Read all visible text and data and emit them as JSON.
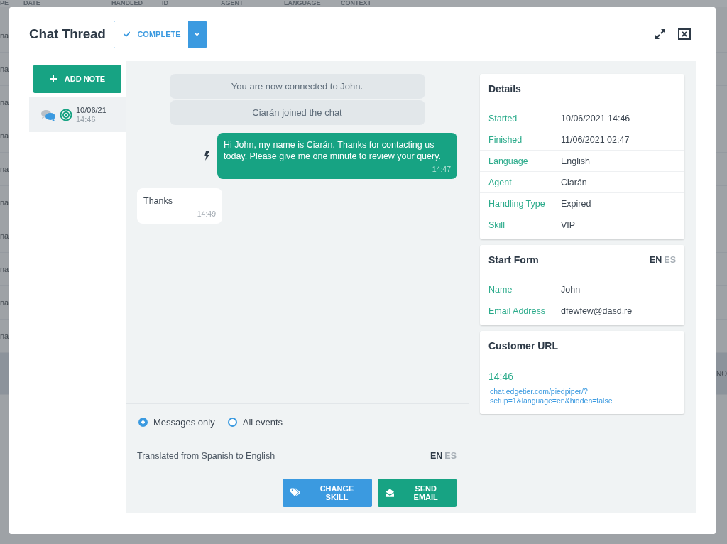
{
  "background_table": {
    "columns": [
      "PE",
      "DATE",
      "HANDLED",
      "ID",
      "AGENT",
      "LANGUAGE",
      "CONTEXT"
    ],
    "rows": [
      {
        "column_1": "na",
        "selected": false
      },
      {
        "column_1": "na",
        "selected": false
      },
      {
        "column_1": "na",
        "selected": false
      },
      {
        "column_1": "na",
        "selected": false
      },
      {
        "column_1": "na",
        "selected": false
      },
      {
        "column_1": "na",
        "selected": false
      },
      {
        "column_1": "na",
        "selected": false
      },
      {
        "column_1": "na",
        "selected": false
      },
      {
        "column_1": "na",
        "selected": false
      },
      {
        "column_1": "na",
        "selected": false
      },
      {
        "column_8": "NO",
        "selected": true
      }
    ]
  },
  "modal": {
    "title": "Chat Thread",
    "status": "COMPLETE",
    "sidebar": {
      "add_note": "ADD NOTE",
      "items": [
        {
          "date": "10/06/21",
          "time": "14:46",
          "selected": true
        }
      ]
    },
    "chat": {
      "messages": [
        {
          "kind": "system",
          "text": "You are now connected to John."
        },
        {
          "kind": "system",
          "text": "Ciarán joined the chat"
        },
        {
          "kind": "agent",
          "text": "Hi John, my name is Ciarán. Thanks for contacting us today. Please give me one minute to review your query.",
          "time": "14:47"
        },
        {
          "kind": "customer",
          "text": "Thanks",
          "time": "14:49"
        }
      ],
      "filters": [
        {
          "label": "Messages only",
          "selected": true
        },
        {
          "label": "All events",
          "selected": false
        }
      ],
      "translation": {
        "text": "Translated from Spanish to English",
        "languages": [
          {
            "code": "EN",
            "selected": true
          },
          {
            "code": "ES",
            "selected": false
          }
        ]
      },
      "buttons": [
        {
          "kind": "tag",
          "label": "CHANGE SKILL"
        },
        {
          "kind": "email",
          "label": "SEND EMAIL"
        }
      ]
    },
    "details": {
      "title": "Details",
      "rows": [
        {
          "label": "Started",
          "value": "10/06/2021 14:46"
        },
        {
          "label": "Finished",
          "value": "11/06/2021 02:47"
        },
        {
          "label": "Language",
          "value": "English"
        },
        {
          "label": "Agent",
          "value": "Ciarán"
        },
        {
          "label": "Handling Type",
          "value": "Expired"
        },
        {
          "label": "Skill",
          "value": "VIP"
        }
      ]
    },
    "start_form": {
      "title": "Start Form",
      "languages": [
        {
          "code": "EN",
          "selected": true
        },
        {
          "code": "ES",
          "selected": false
        }
      ],
      "rows": [
        {
          "label": "Name",
          "value": "John"
        },
        {
          "label": "Email Address",
          "value": "dfewfew@dasd.re"
        }
      ]
    },
    "customer_url": {
      "title": "Customer URL",
      "time": "14:46",
      "url": "chat.edgetier.com/piedpiper/?setup=1&language=en&hidden=false"
    }
  }
}
